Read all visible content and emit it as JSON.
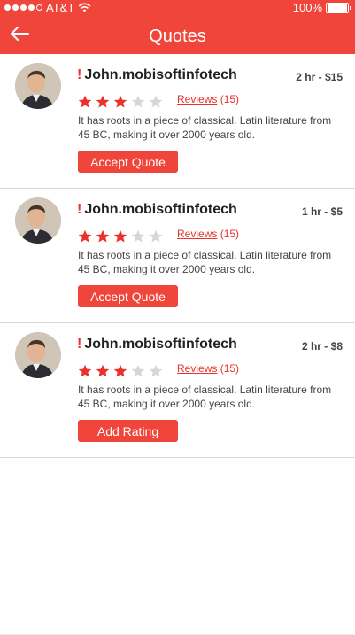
{
  "status_bar": {
    "carrier": "AT&T",
    "battery": "100%",
    "icons": [
      "signal-dots-icon",
      "wifi-icon",
      "battery-icon"
    ]
  },
  "header": {
    "title": "Quotes",
    "back_icon": "arrow-left-icon",
    "color": "#f0453a"
  },
  "quotes": [
    {
      "name": "John.mobisoftinfotech",
      "price": "2 hr - $15",
      "rating": 3,
      "max_rating": 5,
      "reviews_label": "Reviews",
      "reviews_count": "(15)",
      "description": "It has roots in a piece of classical.  Latin literature from 45 BC, making it over 2000 years old.",
      "action": "Accept Quote"
    },
    {
      "name": "John.mobisoftinfotech",
      "price": "1 hr - $5",
      "rating": 3,
      "max_rating": 5,
      "reviews_label": "Reviews",
      "reviews_count": "(15)",
      "description": "It has roots in a piece of classical.  Latin literature from 45 BC, making it over 2000 years old.",
      "action": "Accept Quote"
    },
    {
      "name": "John.mobisoftinfotech",
      "price": "2 hr - $8",
      "rating": 3,
      "max_rating": 5,
      "reviews_label": "Reviews",
      "reviews_count": "(15)",
      "description": "It has roots in a piece of classical.  Latin literature from 45 BC, making it over 2000 years old.",
      "action": "Add Rating"
    }
  ],
  "colors": {
    "accent": "#f0453a",
    "star_filled": "#e8322a",
    "star_empty": "#d6d6d6"
  }
}
